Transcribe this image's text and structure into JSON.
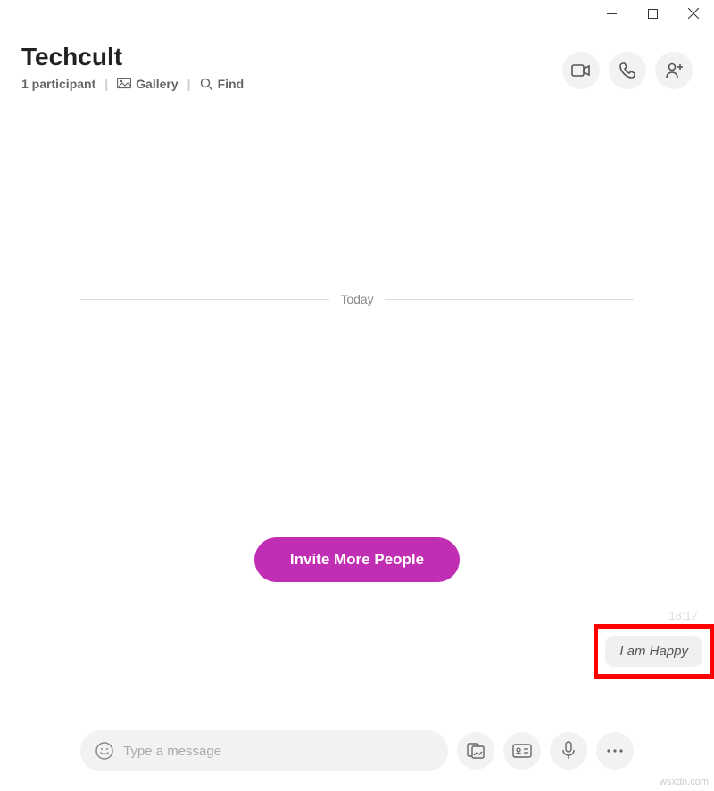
{
  "window": {
    "minimize_title": "Minimize",
    "maximize_title": "Maximize",
    "close_title": "Close"
  },
  "header": {
    "title": "Techcult",
    "participants_label": "1 participant",
    "gallery_label": "Gallery",
    "find_label": "Find"
  },
  "actions": {
    "video_call": "Video call",
    "audio_call": "Audio call",
    "add_person": "Add participants"
  },
  "chat": {
    "date_divider": "Today",
    "invite_button": "Invite More People",
    "message_time": "18:17",
    "message_text": "I am Happy"
  },
  "composer": {
    "placeholder": "Type a message",
    "emoji": "Emoji",
    "file": "Add files",
    "contact": "Share contact",
    "voice": "Record voice",
    "more": "More"
  },
  "watermark": "wsxdn.com"
}
